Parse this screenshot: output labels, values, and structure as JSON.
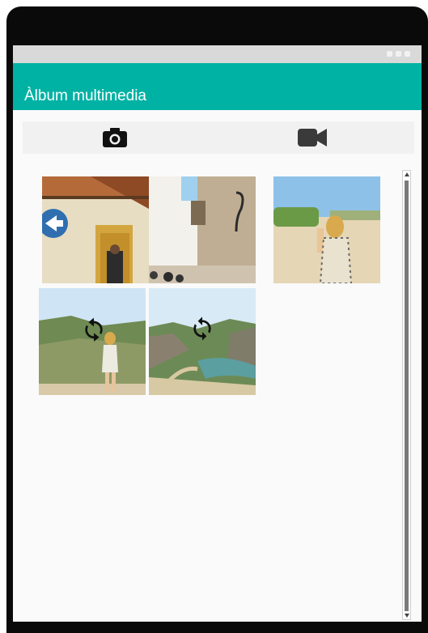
{
  "app": {
    "title": "Àlbum multimedia",
    "accent_color": "#00b2a4"
  },
  "toolbar": {
    "photo_icon": "camera-icon",
    "video_icon": "videocam-icon"
  },
  "gallery": {
    "items": [
      {
        "type": "photo",
        "description_icon": "photo"
      },
      {
        "type": "photo",
        "description_icon": "photo"
      },
      {
        "type": "photo",
        "description_icon": "photo"
      },
      {
        "type": "video",
        "overlay_icon": "refresh-icon"
      },
      {
        "type": "video",
        "overlay_icon": "sync-icon"
      }
    ]
  }
}
